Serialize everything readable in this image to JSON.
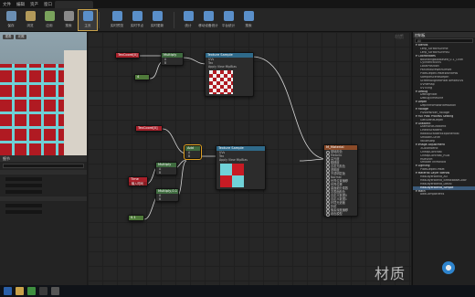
{
  "menu": {
    "items": [
      "文件",
      "编辑",
      "资产",
      "窗口",
      "帮助"
    ]
  },
  "toolbar": {
    "buttons": [
      {
        "label": "保存",
        "color": "#6b8fb3"
      },
      {
        "label": "浏览",
        "color": "#b39a5a"
      },
      {
        "label": "应用",
        "color": "#7aa35c"
      },
      {
        "label": "搜索",
        "color": "#8a8a8a"
      },
      {
        "label": "主页",
        "color": "#8a8a8a"
      },
      {
        "label": "节点",
        "color": "#c9a24a"
      },
      {
        "label": "实时预览",
        "color": "#5a8fc9"
      },
      {
        "label": "实时节点",
        "color": "#5a8fc9"
      },
      {
        "label": "实时更新",
        "color": "#5a8fc9"
      },
      {
        "label": "统计",
        "color": "#5a8fc9"
      },
      {
        "label": "移动设备统计",
        "color": "#5a8fc9"
      },
      {
        "label": "平台统计",
        "color": "#5a8fc9"
      },
      {
        "label": "搜索",
        "color": "#5a8fc9"
      }
    ]
  },
  "viewport": {
    "tab1": "视角",
    "tab2": "光照"
  },
  "details": {
    "title": "细节",
    "search_placeholder": "搜索细节",
    "rows": [
      "",
      "",
      "",
      "",
      ""
    ]
  },
  "graph": {
    "watermark": "材质",
    "zoom": "缩放 -1",
    "nodes": {
      "texcoord1": {
        "title": "TexCoord[0]"
      },
      "multiply1": {
        "title": "Multiply"
      },
      "const1": {
        "title": "4"
      },
      "texsample1": {
        "title": "Texture Sample",
        "pins": [
          "UVs",
          "Tex",
          "Apply View MipBias"
        ],
        "outs": [
          "RGB",
          "R",
          "G",
          "B",
          "A",
          "RGBA"
        ]
      },
      "texcoord2": {
        "title": "TexCoord[0]"
      },
      "add": {
        "title": "Add"
      },
      "texsample2": {
        "title": "Texture Sample",
        "pins": [
          "UVs",
          "Tex",
          "Apply View MipBias"
        ],
        "outs": [
          "RGB",
          "R",
          "G",
          "B",
          "A",
          "RGBA"
        ]
      },
      "time": {
        "title": "Time",
        "sub": "输入时间"
      },
      "multiply2": {
        "title": "Multiply"
      },
      "const2": {
        "title": "0.1"
      },
      "multiply3": {
        "title": "Multiply,0.1"
      },
      "material": {
        "title": "M_Material",
        "pins": [
          "基础颜色",
          "Metallic",
          "高光度",
          "粗糙度",
          "自发光颜色",
          "透明度",
          "不透明蒙版",
          "Normal",
          "世界位置偏移",
          "世界位移",
          "曲面细分乘数",
          "次表面颜色",
          "自定义数据0",
          "自定义数据1",
          "环境光遮蔽",
          "折射",
          "像素深度偏移",
          "着色模型"
        ]
      }
    }
  },
  "palette": {
    "title": "控制板",
    "search": "All",
    "items": [
      {
        "t": "Blends",
        "cat": true
      },
      {
        "t": "Lerp_ScratchGrime"
      },
      {
        "t": "Lerp_ScratchGrime2"
      },
      {
        "t": "Coordinates",
        "cat": true
      },
      {
        "t": "BoundingBoxBased_0-1_UVW"
      },
      {
        "t": "CylindricalUVs"
      },
      {
        "t": "LocalPosition"
      },
      {
        "t": "PanTextureWithOffset"
      },
      {
        "t": "PixelDepthOffsetWorldPos"
      },
      {
        "t": "SampleSceneDepth"
      },
      {
        "t": "ScreenAlignedPixelToPixelUVs"
      },
      {
        "t": "UVRemap"
      },
      {
        "t": "UVTiling"
      },
      {
        "t": "Debug",
        "cat": true
      },
      {
        "t": "DebugFloat"
      },
      {
        "t": "DebugTimeSine"
      },
      {
        "t": "Depth",
        "cat": true
      },
      {
        "t": "DepthFromWorldPosition"
      },
      {
        "t": "Foliage",
        "cat": true
      },
      {
        "t": "PivotPainter_Foliage"
      },
      {
        "t": "Full Post Process Setting",
        "cat": true
      },
      {
        "t": "GetSceneDepth"
      },
      {
        "t": "Gradient",
        "cat": true
      },
      {
        "t": "DiamondGradient"
      },
      {
        "t": "LinearGradient"
      },
      {
        "t": "RadialGradientExponential"
      },
      {
        "t": "SmoothCurve"
      },
      {
        "t": "ValueStep"
      },
      {
        "t": "Image Adjustment",
        "cat": true
      },
      {
        "t": "3ColorBlend"
      },
      {
        "t": "CheapContrast"
      },
      {
        "t": "CheapContrast_RGB"
      },
      {
        "t": "HueShift"
      },
      {
        "t": "SmoothThreshold"
      },
      {
        "t": "Lighting",
        "cat": true
      },
      {
        "t": "PixelDepthOffset"
      },
      {
        "t": "Material Layer Blends",
        "cat": true
      },
      {
        "t": "MatLayerBlend_AO"
      },
      {
        "t": "MatLayerBlend_BreakBaseColor"
      },
      {
        "t": "MatLayerBlend_Decal"
      },
      {
        "t": "MatLayerBlend_Simple",
        "sel": true
      },
      {
        "t": "Math",
        "cat": true
      },
      {
        "t": "AddComponents"
      }
    ]
  },
  "taskbar": {
    "time": "",
    "date": ""
  },
  "overlay": {
    "text": "材质"
  }
}
